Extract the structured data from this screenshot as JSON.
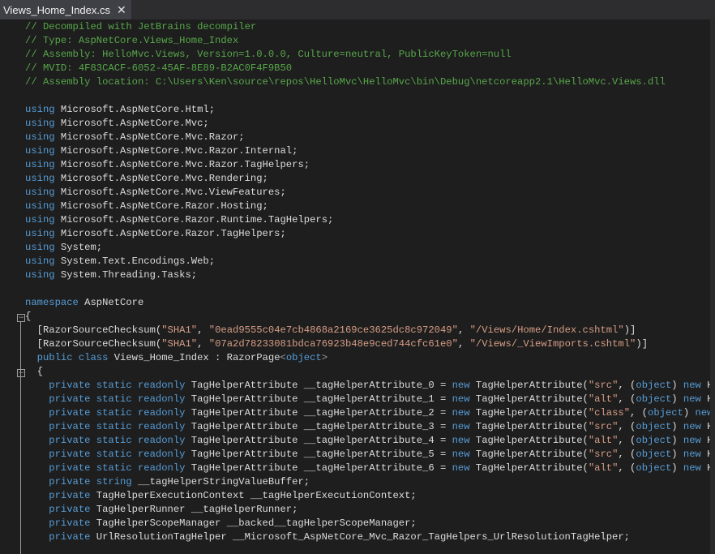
{
  "tab": {
    "title": "Views_Home_Index.cs",
    "close_icon": "close-icon"
  },
  "colors": {
    "comment": "#57a64a",
    "keyword": "#569cd6",
    "string": "#d69d85",
    "text": "#dcdcdc",
    "background": "#1e1e1e"
  },
  "code_lines": [
    [
      [
        "c",
        "// Decompiled with JetBrains decompiler"
      ]
    ],
    [
      [
        "c",
        "// Type: AspNetCore.Views_Home_Index"
      ]
    ],
    [
      [
        "c",
        "// Assembly: HelloMvc.Views, Version=1.0.0.0, Culture=neutral, PublicKeyToken=null"
      ]
    ],
    [
      [
        "c",
        "// MVID: 4F83CACF-6052-45AF-8E89-B2AC0F4F9B50"
      ]
    ],
    [
      [
        "c",
        "// Assembly location: C:\\Users\\Ken\\source\\repos\\HelloMvc\\HelloMvc\\bin\\Debug\\netcoreapp2.1\\HelloMvc.Views.dll"
      ]
    ],
    [],
    [
      [
        "k",
        "using"
      ],
      [
        "p",
        " Microsoft.AspNetCore.Html;"
      ]
    ],
    [
      [
        "k",
        "using"
      ],
      [
        "p",
        " Microsoft.AspNetCore.Mvc;"
      ]
    ],
    [
      [
        "k",
        "using"
      ],
      [
        "p",
        " Microsoft.AspNetCore.Mvc.Razor;"
      ]
    ],
    [
      [
        "k",
        "using"
      ],
      [
        "p",
        " Microsoft.AspNetCore.Mvc.Razor.Internal;"
      ]
    ],
    [
      [
        "k",
        "using"
      ],
      [
        "p",
        " Microsoft.AspNetCore.Mvc.Razor.TagHelpers;"
      ]
    ],
    [
      [
        "k",
        "using"
      ],
      [
        "p",
        " Microsoft.AspNetCore.Mvc.Rendering;"
      ]
    ],
    [
      [
        "k",
        "using"
      ],
      [
        "p",
        " Microsoft.AspNetCore.Mvc.ViewFeatures;"
      ]
    ],
    [
      [
        "k",
        "using"
      ],
      [
        "p",
        " Microsoft.AspNetCore.Razor.Hosting;"
      ]
    ],
    [
      [
        "k",
        "using"
      ],
      [
        "p",
        " Microsoft.AspNetCore.Razor.Runtime.TagHelpers;"
      ]
    ],
    [
      [
        "k",
        "using"
      ],
      [
        "p",
        " Microsoft.AspNetCore.Razor.TagHelpers;"
      ]
    ],
    [
      [
        "k",
        "using"
      ],
      [
        "p",
        " System;"
      ]
    ],
    [
      [
        "k",
        "using"
      ],
      [
        "p",
        " System.Text.Encodings.Web;"
      ]
    ],
    [
      [
        "k",
        "using"
      ],
      [
        "p",
        " System.Threading.Tasks;"
      ]
    ],
    [],
    [
      [
        "k",
        "namespace"
      ],
      [
        "p",
        " AspNetCore"
      ]
    ],
    [
      [
        "p",
        "{"
      ]
    ],
    [
      [
        "p",
        "  [RazorSourceChecksum("
      ],
      [
        "s",
        "\"SHA1\""
      ],
      [
        "p",
        ", "
      ],
      [
        "s",
        "\"0ead9555c04e7cb4868a2169ce3625dc8c972049\""
      ],
      [
        "p",
        ", "
      ],
      [
        "s",
        "\"/Views/Home/Index.cshtml\""
      ],
      [
        "p",
        ")]"
      ]
    ],
    [
      [
        "p",
        "  [RazorSourceChecksum("
      ],
      [
        "s",
        "\"SHA1\""
      ],
      [
        "p",
        ", "
      ],
      [
        "s",
        "\"07a2d78233081bdca76923b48e9ced744cfc61e0\""
      ],
      [
        "p",
        ", "
      ],
      [
        "s",
        "\"/Views/_ViewImports.cshtml\""
      ],
      [
        "p",
        ")]"
      ]
    ],
    [
      [
        "k",
        "  public class"
      ],
      [
        "p",
        " Views_Home_Index : RazorPage"
      ],
      [
        "g",
        "<"
      ],
      [
        "k",
        "object"
      ],
      [
        "g",
        ">"
      ]
    ],
    [
      [
        "p",
        "  {"
      ]
    ],
    [
      [
        "k",
        "    private static readonly"
      ],
      [
        "p",
        " TagHelperAttribute __tagHelperAttribute_0 = "
      ],
      [
        "k",
        "new"
      ],
      [
        "p",
        " TagHelperAttribute("
      ],
      [
        "s",
        "\"src\""
      ],
      [
        "p",
        ", ("
      ],
      [
        "k",
        "object"
      ],
      [
        "p",
        ") "
      ],
      [
        "k",
        "new"
      ],
      [
        "p",
        " H"
      ]
    ],
    [
      [
        "k",
        "    private static readonly"
      ],
      [
        "p",
        " TagHelperAttribute __tagHelperAttribute_1 = "
      ],
      [
        "k",
        "new"
      ],
      [
        "p",
        " TagHelperAttribute("
      ],
      [
        "s",
        "\"alt\""
      ],
      [
        "p",
        ", ("
      ],
      [
        "k",
        "object"
      ],
      [
        "p",
        ") "
      ],
      [
        "k",
        "new"
      ],
      [
        "p",
        " H"
      ]
    ],
    [
      [
        "k",
        "    private static readonly"
      ],
      [
        "p",
        " TagHelperAttribute __tagHelperAttribute_2 = "
      ],
      [
        "k",
        "new"
      ],
      [
        "p",
        " TagHelperAttribute("
      ],
      [
        "s",
        "\"class\""
      ],
      [
        "p",
        ", ("
      ],
      [
        "k",
        "object"
      ],
      [
        "p",
        ") "
      ],
      [
        "k",
        "new"
      ]
    ],
    [
      [
        "k",
        "    private static readonly"
      ],
      [
        "p",
        " TagHelperAttribute __tagHelperAttribute_3 = "
      ],
      [
        "k",
        "new"
      ],
      [
        "p",
        " TagHelperAttribute("
      ],
      [
        "s",
        "\"src\""
      ],
      [
        "p",
        ", ("
      ],
      [
        "k",
        "object"
      ],
      [
        "p",
        ") "
      ],
      [
        "k",
        "new"
      ],
      [
        "p",
        " H"
      ]
    ],
    [
      [
        "k",
        "    private static readonly"
      ],
      [
        "p",
        " TagHelperAttribute __tagHelperAttribute_4 = "
      ],
      [
        "k",
        "new"
      ],
      [
        "p",
        " TagHelperAttribute("
      ],
      [
        "s",
        "\"alt\""
      ],
      [
        "p",
        ", ("
      ],
      [
        "k",
        "object"
      ],
      [
        "p",
        ") "
      ],
      [
        "k",
        "new"
      ],
      [
        "p",
        " H"
      ]
    ],
    [
      [
        "k",
        "    private static readonly"
      ],
      [
        "p",
        " TagHelperAttribute __tagHelperAttribute_5 = "
      ],
      [
        "k",
        "new"
      ],
      [
        "p",
        " TagHelperAttribute("
      ],
      [
        "s",
        "\"src\""
      ],
      [
        "p",
        ", ("
      ],
      [
        "k",
        "object"
      ],
      [
        "p",
        ") "
      ],
      [
        "k",
        "new"
      ],
      [
        "p",
        " H"
      ]
    ],
    [
      [
        "k",
        "    private static readonly"
      ],
      [
        "p",
        " TagHelperAttribute __tagHelperAttribute_6 = "
      ],
      [
        "k",
        "new"
      ],
      [
        "p",
        " TagHelperAttribute("
      ],
      [
        "s",
        "\"alt\""
      ],
      [
        "p",
        ", ("
      ],
      [
        "k",
        "object"
      ],
      [
        "p",
        ") "
      ],
      [
        "k",
        "new"
      ],
      [
        "p",
        " H"
      ]
    ],
    [
      [
        "k",
        "    private string"
      ],
      [
        "p",
        " __tagHelperStringValueBuffer;"
      ]
    ],
    [
      [
        "k",
        "    private"
      ],
      [
        "p",
        " TagHelperExecutionContext __tagHelperExecutionContext;"
      ]
    ],
    [
      [
        "k",
        "    private"
      ],
      [
        "p",
        " TagHelperRunner __tagHelperRunner;"
      ]
    ],
    [
      [
        "k",
        "    private"
      ],
      [
        "p",
        " TagHelperScopeManager __backed__tagHelperScopeManager;"
      ]
    ],
    [
      [
        "k",
        "    private"
      ],
      [
        "p",
        " UrlResolutionTagHelper __Microsoft_AspNetCore_Mvc_Razor_TagHelpers_UrlResolutionTagHelper;"
      ]
    ]
  ]
}
